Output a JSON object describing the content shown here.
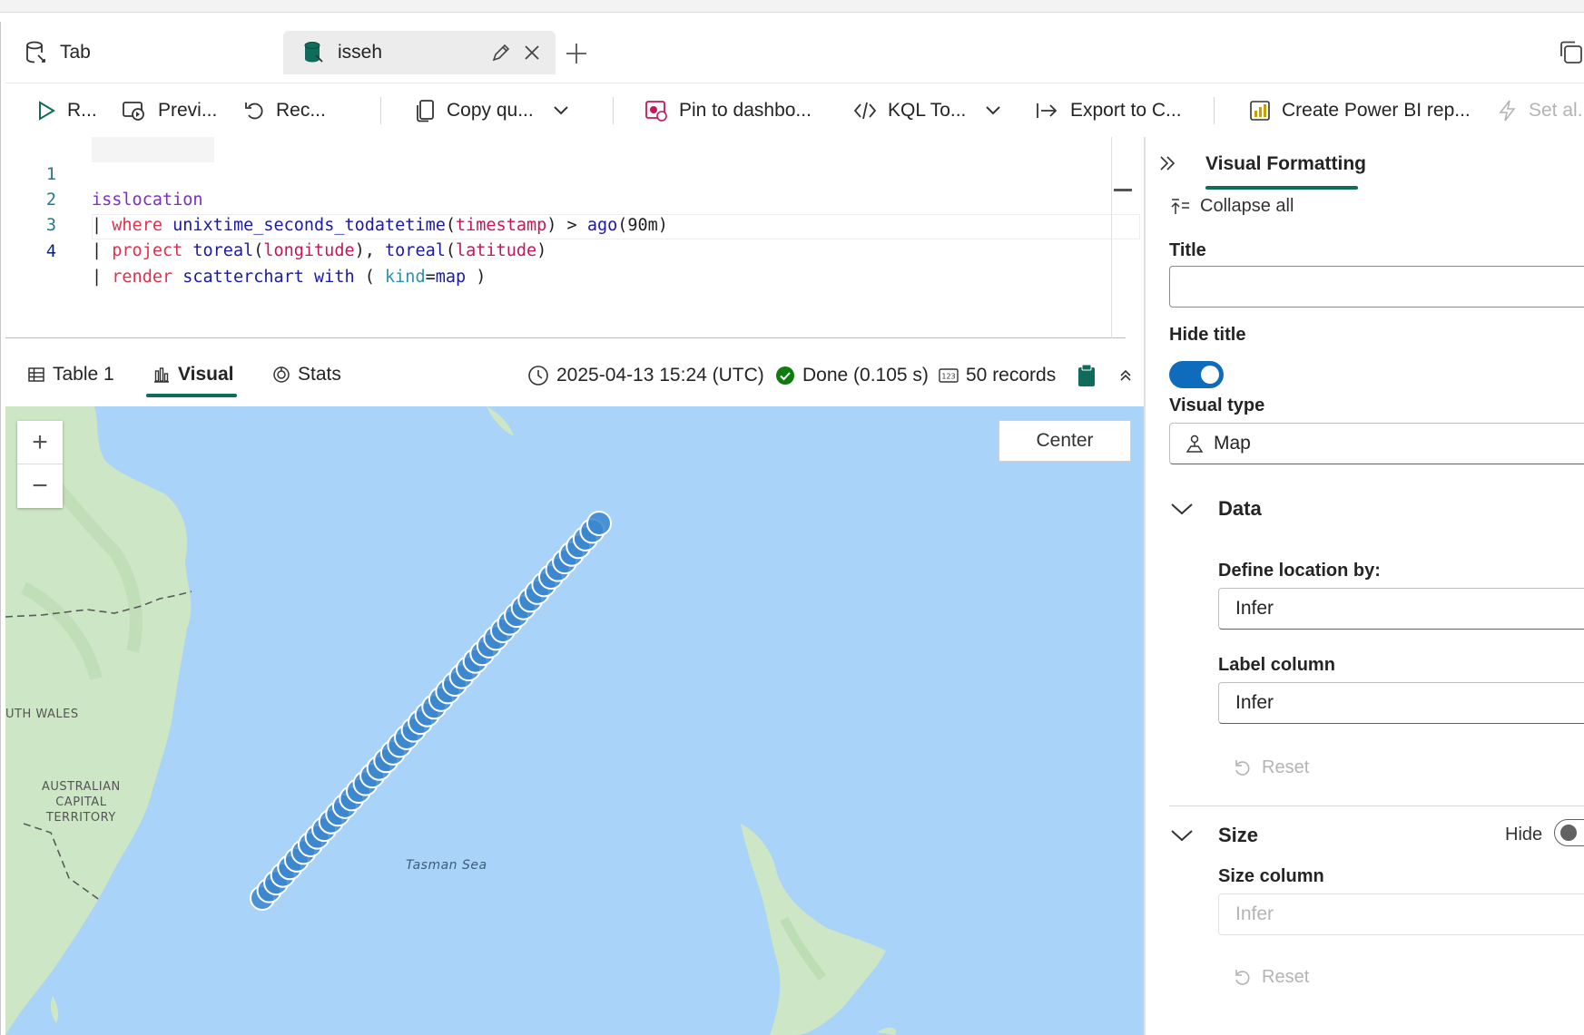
{
  "tabs": [
    {
      "label": "Tab",
      "active": false
    },
    {
      "label": "isseh",
      "active": true
    }
  ],
  "toolbar": {
    "run": "R...",
    "preview": "Previ...",
    "recall": "Rec...",
    "copy_query": "Copy qu...",
    "pin": "Pin to dashbo...",
    "kql_tools": "KQL To...",
    "export": "Export to C...",
    "power_bi": "Create Power BI rep...",
    "set_alert": "Set al..."
  },
  "editor": {
    "line_numbers": [
      "1",
      "2",
      "3",
      "4"
    ],
    "line1": {
      "table": "isslocation"
    },
    "line2": {
      "pipe": "|",
      "kw": "where",
      "fn": "unixtime_seconds_todatetime",
      "p1": "(",
      "col": "timestamp",
      "p2": ")",
      "op": " > ",
      "fn2": "ago",
      "arg": "(90m)"
    },
    "line3": {
      "pipe": "|",
      "kw": "project",
      "fn1": "toreal",
      "p1": "(",
      "col1": "longitude",
      "p2": "), ",
      "fn2": "toreal",
      "p3": "(",
      "col2": "latitude",
      "p4": ")"
    },
    "line4": {
      "pipe": "|",
      "kw": "render",
      "fn": "scatterchart",
      "with": "with",
      "p1": " ( ",
      "kind": "kind",
      "eq": "=",
      "val": "map",
      "p2": " )"
    }
  },
  "results": {
    "tabs": [
      {
        "label": "Table 1"
      },
      {
        "label": "Visual"
      },
      {
        "label": "Stats"
      }
    ],
    "timestamp": "2025-04-13 15:24 (UTC)",
    "status": "Done (0.105 s)",
    "records": "50 records"
  },
  "map": {
    "zoom_in": "+",
    "zoom_out": "−",
    "center_label": "Center",
    "labels": {
      "nsw": "UTH WALES",
      "act": [
        "AUSTRALIAN",
        "CAPITAL",
        "TERRITORY"
      ],
      "sea": "Tasman Sea"
    },
    "point_color": "#3a86cf"
  },
  "panel": {
    "tab": "Visual Formatting",
    "collapse_all": "Collapse all",
    "title_label": "Title",
    "title_value": "",
    "hide_title_label": "Hide title",
    "hide_title_on": true,
    "visual_type_label": "Visual type",
    "visual_type_value": "Map",
    "data_section": "Data",
    "define_location_label": "Define location by:",
    "define_location_value": "Infer",
    "label_column_label": "Label column",
    "label_column_value": "Infer",
    "reset": "Reset",
    "size_section": "Size",
    "size_hide_label": "Hide",
    "size_column_label": "Size column",
    "size_column_value": "Infer"
  },
  "colors": {
    "accent": "#0f6c5b",
    "toggle_on": "#0f6cbd",
    "sea": "#a9d3f8",
    "land": "#cfe8c7"
  }
}
